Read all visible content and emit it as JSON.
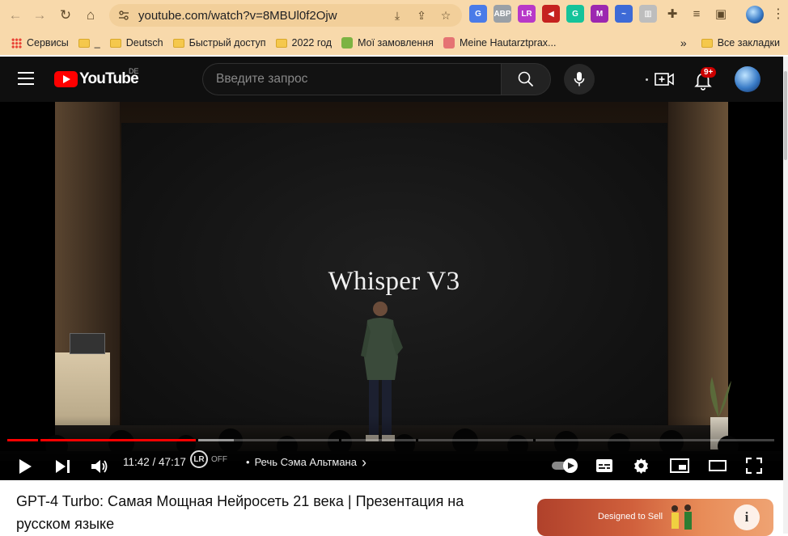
{
  "browser": {
    "url": "youtube.com/watch?v=8MBUl0f2Ojw",
    "bookmarks": [
      {
        "label": "Сервисы",
        "icon": "apps-grid-icon"
      },
      {
        "label": "_",
        "icon": "folder-icon"
      },
      {
        "label": "Deutsch",
        "icon": "folder-icon"
      },
      {
        "label": "Быстрый доступ",
        "icon": "folder-icon"
      },
      {
        "label": "2022 год",
        "icon": "folder-icon"
      },
      {
        "label": "Мої замовлення",
        "icon": "favicon-icon"
      },
      {
        "label": "Meine Hautarztprax...",
        "icon": "favicon-icon"
      }
    ],
    "bookmarks_more": "»",
    "all_bookmarks": "Все закладки",
    "extensions": [
      {
        "name": "translate-icon",
        "color": "#4a7be8",
        "text": "G"
      },
      {
        "name": "adblock-icon",
        "color": "#9aa0a6",
        "text": "ABP"
      },
      {
        "name": "lr-extension-icon",
        "color": "#b838c8",
        "text": "LR"
      },
      {
        "name": "megaphone-icon",
        "color": "#c5221f",
        "text": "◀"
      },
      {
        "name": "grammarly-icon",
        "color": "#15c39a",
        "text": "G"
      },
      {
        "name": "m-extension-icon",
        "color": "#9c27b0",
        "text": "M"
      },
      {
        "name": "wave-icon",
        "color": "#3d6ad6",
        "text": "~"
      },
      {
        "name": "gray-extension-icon",
        "color": "#bdbdbd",
        "text": "▥"
      },
      {
        "name": "puzzle-icon",
        "color": "#5f4a2b",
        "text": "✚"
      },
      {
        "name": "playlist-icon",
        "color": "#5f4a2b",
        "text": "≡"
      },
      {
        "name": "sidepanel-icon",
        "color": "#5f4a2b",
        "text": "▣"
      }
    ]
  },
  "youtube": {
    "logo_text": "YouTube",
    "region": "DE",
    "search_placeholder": "Введите запрос",
    "notification_badge": "9+"
  },
  "player": {
    "screen_text": "Whisper V3",
    "time_current": "11:42",
    "time_separator": " / ",
    "time_total": "47:17",
    "played_fraction": 0.247,
    "loaded_fraction": 0.295,
    "lr_badge": "LR",
    "lr_state": "OFF",
    "chapter_bullet": "•",
    "chapter_title": "Речь Сэма Альтмана",
    "chapter_chevron": "›"
  },
  "video": {
    "title": "GPT-4 Turbo: Самая Мощная Нейросеть 21 века | Презентация на русском языке"
  },
  "ad": {
    "text": "Designed to Sell"
  }
}
